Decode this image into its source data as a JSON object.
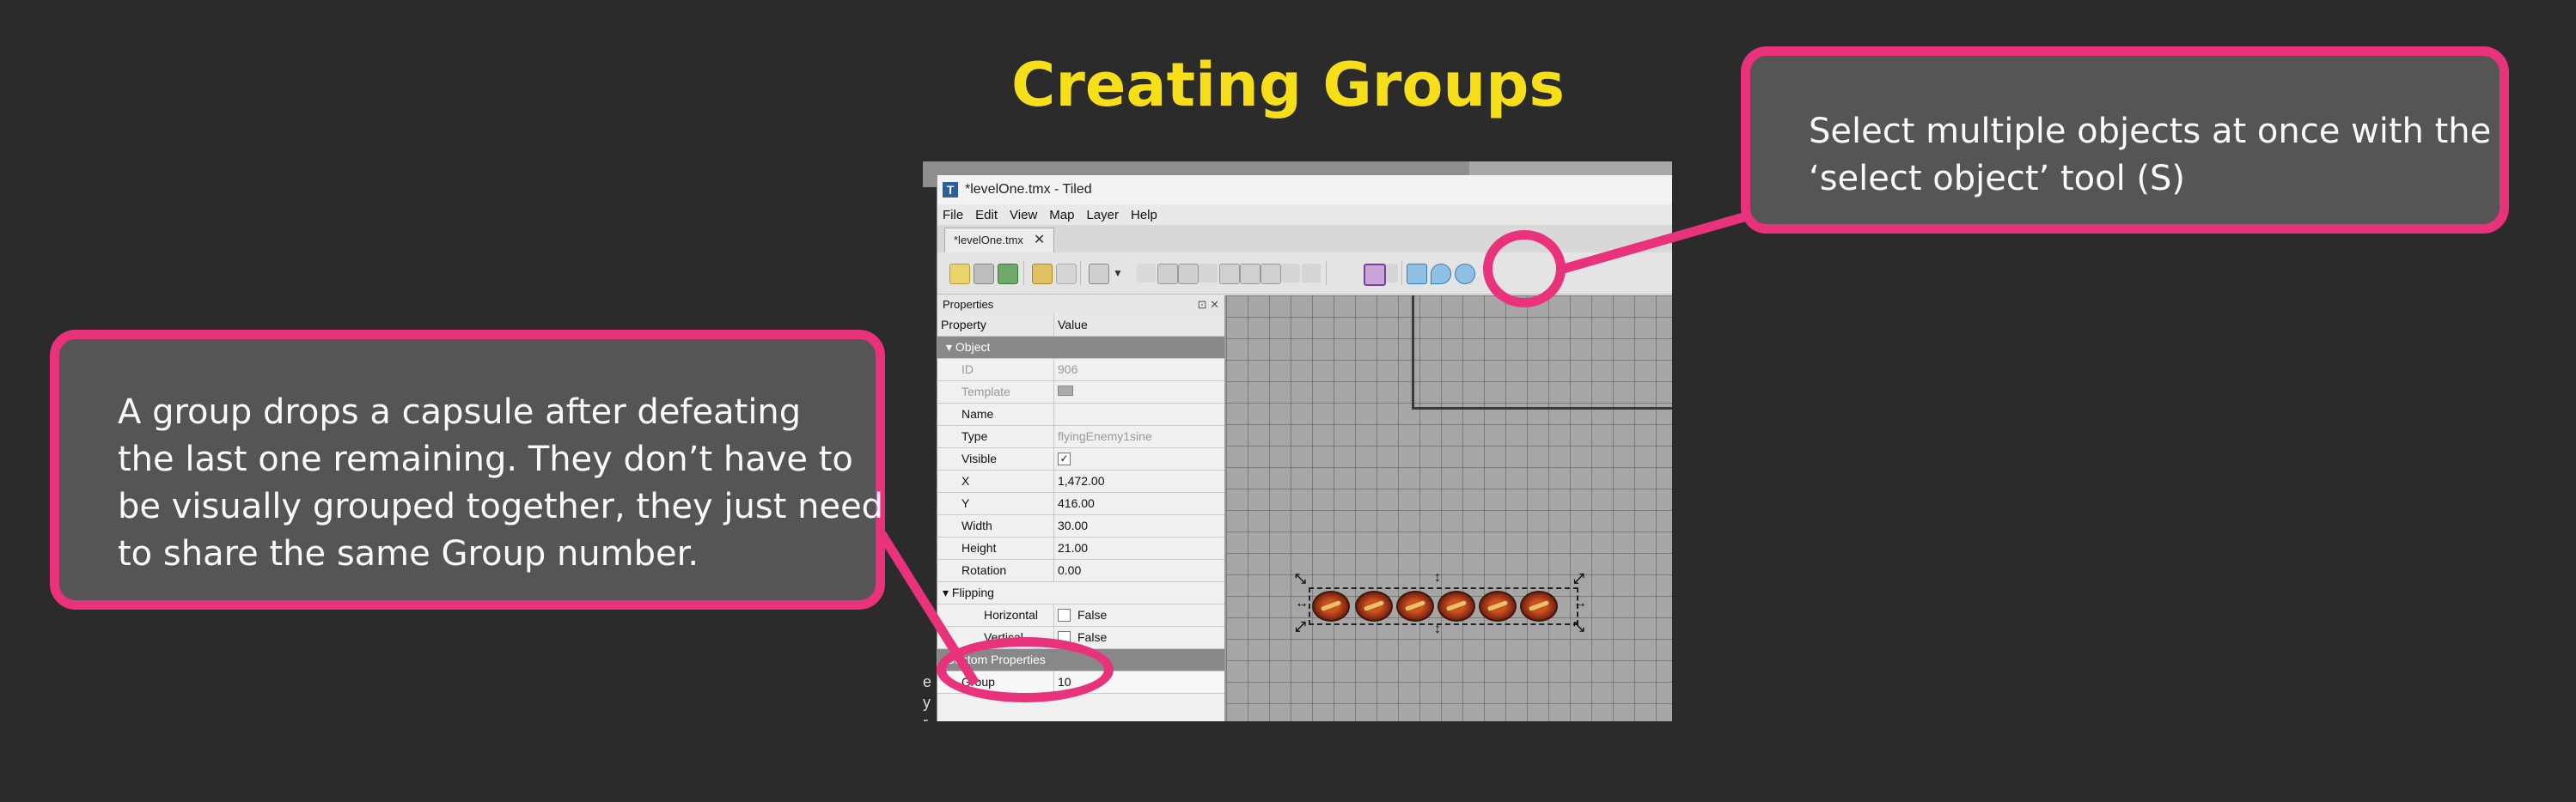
{
  "slide": {
    "title": "Creating Groups",
    "left_callout_lines": [
      "A group drops a capsule after defeating",
      "the last one remaining. They don’t have to",
      "be visually grouped together, they just need",
      "to share the same Group number."
    ],
    "right_callout_lines": [
      "Select multiple objects at once with the",
      "‘select object’ tool (S)"
    ],
    "accent_color": "#e8327c",
    "title_color": "#f6df1a"
  },
  "tiled": {
    "window_title": "*levelOne.tmx - Tiled",
    "menu": [
      "File",
      "Edit",
      "View",
      "Map",
      "Layer",
      "Help"
    ],
    "tab_label": "*levelOne.tmx",
    "tab_close": "✕",
    "left_strip_letters": [
      "e",
      "y",
      "r"
    ],
    "properties": {
      "panel_title": "Properties",
      "panel_controls": "⊡ ✕",
      "col_property": "Property",
      "col_value": "Value",
      "object_section": "Object",
      "rows": {
        "id": {
          "k": "ID",
          "v": "906"
        },
        "template": {
          "k": "Template",
          "v": ""
        },
        "name": {
          "k": "Name",
          "v": ""
        },
        "type": {
          "k": "Type",
          "v": "flyingEnemy1sine"
        },
        "visible": {
          "k": "Visible",
          "v": "✓"
        },
        "x": {
          "k": "X",
          "v": "1,472.00"
        },
        "y": {
          "k": "Y",
          "v": "416.00"
        },
        "width": {
          "k": "Width",
          "v": "30.00"
        },
        "height": {
          "k": "Height",
          "v": "21.00"
        },
        "rotation": {
          "k": "Rotation",
          "v": "0.00"
        }
      },
      "flipping_section": "Flipping",
      "horizontal": {
        "k": "Horizontal",
        "v": "False"
      },
      "vertical": {
        "k": "Vertical",
        "v": "False"
      },
      "custom_section": "Custom Properties",
      "group": {
        "k": "Group",
        "v": "10"
      }
    }
  }
}
